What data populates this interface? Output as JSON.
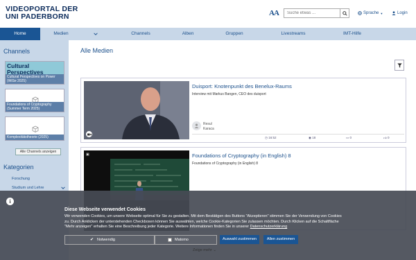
{
  "header": {
    "logo_line1": "VIDEOPORTAL DER",
    "logo_line2": "UNI PADERBORN",
    "font_size_icon": "AA",
    "search_placeholder": "Suche etwas ...",
    "language_label": "Sprache",
    "login_label": "Login"
  },
  "nav": {
    "items": [
      {
        "label": "Home"
      },
      {
        "label": "Medien"
      },
      {
        "label": "Channels"
      },
      {
        "label": "Alben"
      },
      {
        "label": "Gruppen"
      },
      {
        "label": "Livestreams"
      },
      {
        "label": "IMT-Hilfe"
      }
    ]
  },
  "sidebar": {
    "channels_title": "Channels",
    "channels": [
      {
        "thumb_text": "Cultural Perspectives",
        "label": "Cultural Perspectives on Power (WiSe 2025)"
      },
      {
        "label": "Foundations of Cryptography (Summer Term 2025)"
      },
      {
        "label": "Komplexitätstheorie (2025)"
      }
    ],
    "all_channels_button": "Alle Channels anzeigen",
    "categories_title": "Kategorien",
    "categories": [
      {
        "label": "Forschung"
      },
      {
        "label": "Studium und Lehre"
      }
    ]
  },
  "main": {
    "title": "Alle Medien",
    "media": [
      {
        "title": "Duisport: Knotenpunkt des Benelux-Raums",
        "subtitle": "Interview mit Markus Bangen, CEO des duisport",
        "author_line1": "Resul",
        "author_line2": "Karaca",
        "duration": "16:52",
        "views": "18",
        "comments": "0",
        "likes": "0"
      },
      {
        "title": "Foundations of Cryptography (in English) 8",
        "subtitle": "Foundations of Cryptography (in English) 8"
      }
    ]
  },
  "cookie": {
    "title": "Diese Webseite verwendet Cookies",
    "text": "Wir verwenden Cookies, um unsere Webseite optimal für Sie zu gestalten. Mit dem Bestätigen des Buttons \"Akzeptieren\" stimmen Sie der Verwendung von Cookies zu. Durch Anklicken der unterstehenden Checkboxen können Sie auswählen, welche Cookie-Kategorien Sie zulassen möchten. Durch Klicken auf die Schaltfläche \"Mehr anzeigen\" erhalten Sie eine Beschreibung jeder Kategorie. Weitere Informationen finden Sie in unserer",
    "link": "Datenschutzerklärung",
    "check_notwendig": "Notwendig",
    "check_matomo": "Matomo",
    "btn_selection": "Auswahl zustimmen",
    "btn_all": "Allen zustimmen",
    "more": "Zeige mehr"
  },
  "colors": {
    "primary": "#1a5594",
    "nav_bg": "#c8d7e8"
  }
}
